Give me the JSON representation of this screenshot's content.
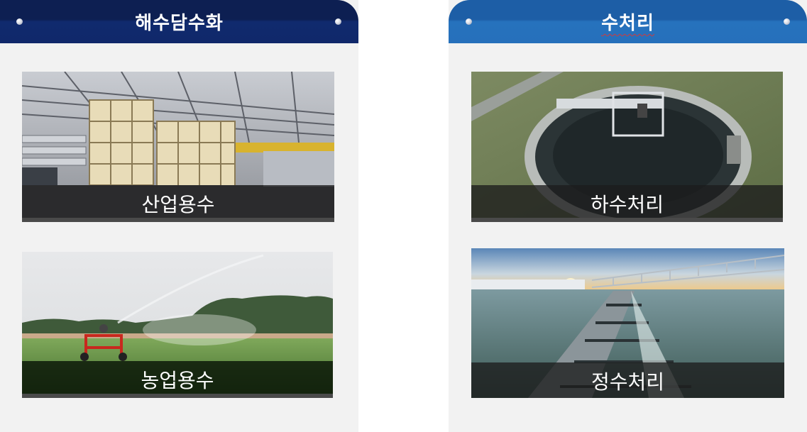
{
  "panels": {
    "left": {
      "title": "해수담수화",
      "cards": [
        {
          "label": "산업용수",
          "image": "industrial-plant-photo"
        },
        {
          "label": "농업용수",
          "image": "irrigation-sprinkler-photo"
        }
      ]
    },
    "right": {
      "title": "수처리",
      "cards": [
        {
          "label": "하수처리",
          "image": "circular-clarifier-tank-photo"
        },
        {
          "label": "정수처리",
          "image": "water-treatment-weir-photo"
        }
      ]
    }
  },
  "colors": {
    "left_header": "#0d1f52",
    "right_header": "#2672bd",
    "panel_background": "#f2f2f2",
    "caption_bar": "#1c1c1c"
  }
}
